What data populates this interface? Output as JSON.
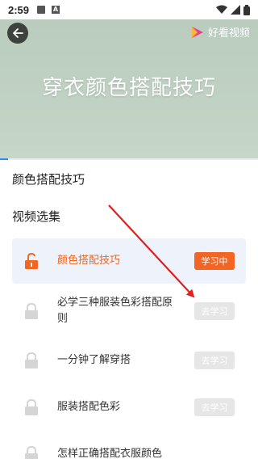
{
  "status_bar": {
    "time": "2:59",
    "icons": [
      "image-icon",
      "text-a-icon",
      "wifi-icon",
      "signal-icon",
      "battery-icon"
    ]
  },
  "video": {
    "title": "穿衣颜色搭配技巧",
    "logo_text": "好看视频",
    "progress": 0.03
  },
  "course": {
    "title": "颜色搭配技巧"
  },
  "section": {
    "title": "视频选集"
  },
  "lessons": [
    {
      "name": "颜色搭配技巧",
      "button": "学习中",
      "active": true
    },
    {
      "name": "必学三种服装色彩搭配原则",
      "button": "去学习",
      "active": false
    },
    {
      "name": "一分钟了解穿搭",
      "button": "去学习",
      "active": false
    },
    {
      "name": "服装搭配色彩",
      "button": "去学习",
      "active": false
    },
    {
      "name": "怎样正确搭配衣服颜色",
      "button": "",
      "active": false
    }
  ],
  "colors": {
    "accent": "#f26522",
    "annotation_arrow": "#e02020",
    "video_bg": "#bccfbf"
  }
}
